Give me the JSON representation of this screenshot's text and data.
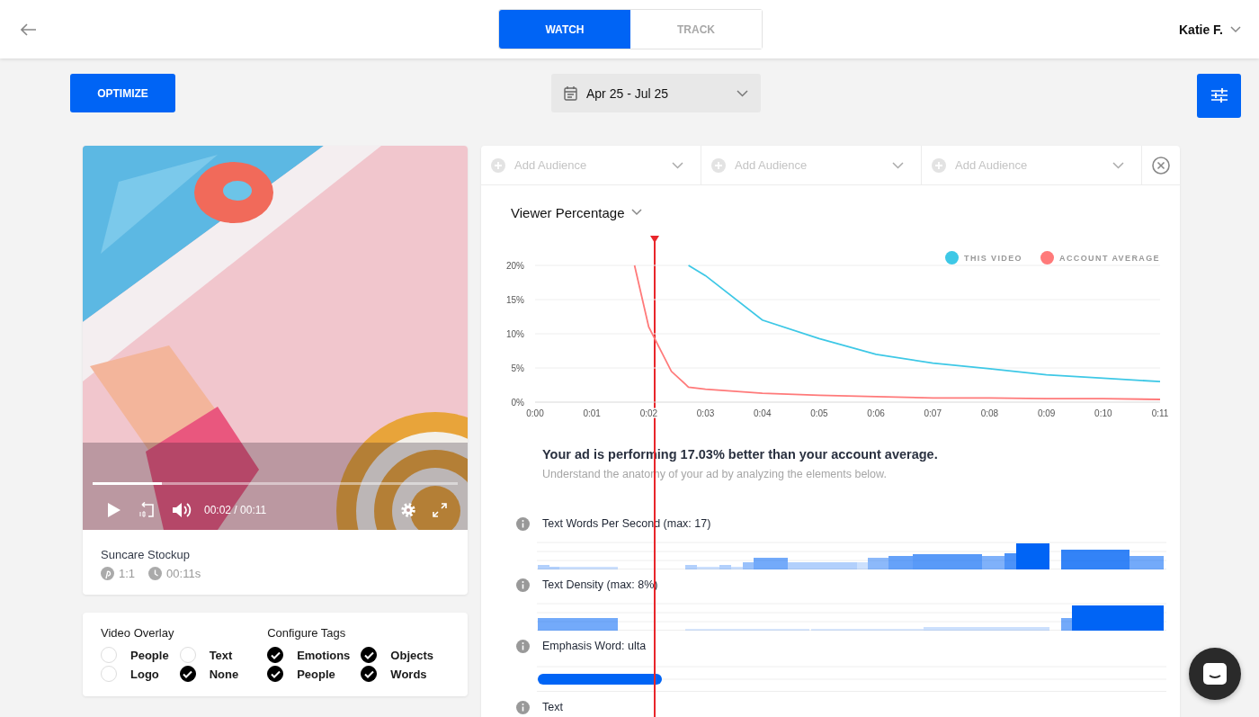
{
  "header": {
    "tabs": [
      {
        "label": "WATCH",
        "selected": true
      },
      {
        "label": "TRACK",
        "selected": false
      }
    ],
    "user": "Katie F."
  },
  "toolbar": {
    "optimize": "OPTIMIZE",
    "date_range": "Apr 25 - Jul 25"
  },
  "video": {
    "progress": {
      "level": 0.19
    },
    "time": "00:02 / 00:11",
    "title": "Suncare Stockup",
    "ratio": "1:1",
    "duration": "00:11s"
  },
  "overlay_panel": {
    "groups": [
      {
        "title": "Video Overlay",
        "options": [
          {
            "label": "People",
            "checked": false
          },
          {
            "label": "Text",
            "checked": false
          },
          {
            "label": "Logo",
            "checked": false
          },
          {
            "label": "None",
            "checked": true
          }
        ]
      },
      {
        "title": "Configure Tags",
        "options": [
          {
            "label": "Emotions",
            "checked": true
          },
          {
            "label": "Objects",
            "checked": true
          },
          {
            "label": "People",
            "checked": true
          },
          {
            "label": "Words",
            "checked": true
          }
        ]
      }
    ]
  },
  "audiences": [
    {
      "placeholder": "Add Audience"
    },
    {
      "placeholder": "Add Audience"
    },
    {
      "placeholder": "Add Audience"
    }
  ],
  "metric_select": "Viewer Percentage",
  "chart_data": {
    "type": "line",
    "x": [
      1.75,
      2,
      2.4,
      2.7,
      3,
      4,
      5,
      6,
      7,
      8,
      9,
      10,
      11
    ],
    "series": [
      {
        "name": "THIS VIDEO",
        "color": "#3ec8e6",
        "values": [
          null,
          null,
          null,
          20,
          18.5,
          12,
          9.3,
          7,
          5.7,
          4.9,
          4,
          3.5,
          3
        ]
      },
      {
        "name": "ACCOUNT AVERAGE",
        "color": "#ff7a7a",
        "values": [
          20,
          11,
          4.5,
          2.2,
          1.9,
          1.3,
          1,
          0.8,
          0.6,
          0.6,
          0.5,
          0.5,
          0.4
        ]
      }
    ],
    "grid": true,
    "legend": true,
    "xlim": [
      0,
      11
    ],
    "ylim": [
      0,
      20
    ],
    "xticks": [
      {
        "value": 0,
        "label": "0:00"
      },
      {
        "value": 1,
        "label": "0:01"
      },
      {
        "value": 2,
        "label": "0:02"
      },
      {
        "value": 3,
        "label": "0:03"
      },
      {
        "value": 4,
        "label": "0:04"
      },
      {
        "value": 5,
        "label": "0:05"
      },
      {
        "value": 6,
        "label": "0:06"
      },
      {
        "value": 7,
        "label": "0:07"
      },
      {
        "value": 8,
        "label": "0:08"
      },
      {
        "value": 9,
        "label": "0:09"
      },
      {
        "value": 10,
        "label": "0:10"
      },
      {
        "value": 11,
        "label": "0:11"
      }
    ],
    "yticks": [
      {
        "value": 0,
        "label": "0%"
      },
      {
        "value": 5,
        "label": "5%"
      },
      {
        "value": 10,
        "label": "10%"
      },
      {
        "value": 15,
        "label": "15%"
      },
      {
        "value": 20,
        "label": "20%"
      }
    ]
  },
  "summary": {
    "headline": "Your ad is performing 17.03% better than your account average.",
    "subtitle": "Understand the anatomy of your ad by analyzing the elements below."
  },
  "elements": [
    {
      "label": "Text Words Per Second (max: 17)",
      "kind": "bars"
    },
    {
      "label": "Text Density (max: 8%)",
      "kind": "bars"
    },
    {
      "label": "Emphasis Word: ulta",
      "kind": "pill"
    },
    {
      "label": "Text",
      "kind": "cut"
    }
  ]
}
